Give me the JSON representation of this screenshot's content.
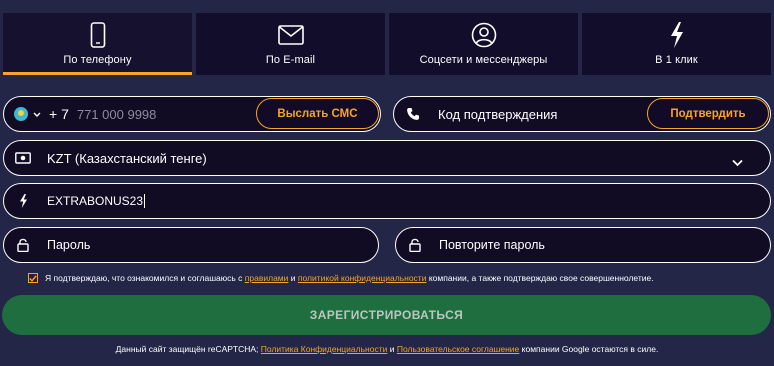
{
  "tabs": [
    {
      "label": "По телефону",
      "icon": "phone-icon",
      "active": true
    },
    {
      "label": "По E-mail",
      "icon": "mail-icon",
      "active": false
    },
    {
      "label": "Соцсети и мессенджеры",
      "icon": "user-circle-icon",
      "active": false
    },
    {
      "label": "В 1 клик",
      "icon": "lightning-icon",
      "active": false
    }
  ],
  "phone": {
    "prefix": "+ 7",
    "placeholder": "771 000 9998",
    "send_sms_label": "Выслать СМС",
    "country_flag": "kazakhstan-flag-icon"
  },
  "code": {
    "placeholder": "Код подтверждения",
    "confirm_label": "Подтвердить"
  },
  "currency": {
    "selected": "KZT (Казахстанский тенге)"
  },
  "promo": {
    "value": "EXTRABONUS23"
  },
  "password": {
    "placeholder": "Пароль",
    "repeat_placeholder": "Повторите пароль"
  },
  "agreement": {
    "checked": true,
    "text_before": "Я подтверждаю, что ознакомился и соглашаюсь с",
    "rules_link": "правилами",
    "and": "и",
    "privacy_link": "политикой конфиденциальности",
    "text_after": "компании, а также подтверждаю свое совершеннолетие."
  },
  "submit_label": "ЗАРЕГИСТРИРОВАТЬСЯ",
  "footer": {
    "text_before": "Данный сайт защищён reCAPTCHA;",
    "policy_link": "Политика Конфиденциальности",
    "and": "и",
    "terms_link": "Пользовательское соглашение",
    "text_after": "компании Google остаются в силе."
  },
  "colors": {
    "background": "#232647",
    "accent": "#f6a622",
    "submit": "#1f6e3f",
    "input_bg": "#110c23"
  }
}
